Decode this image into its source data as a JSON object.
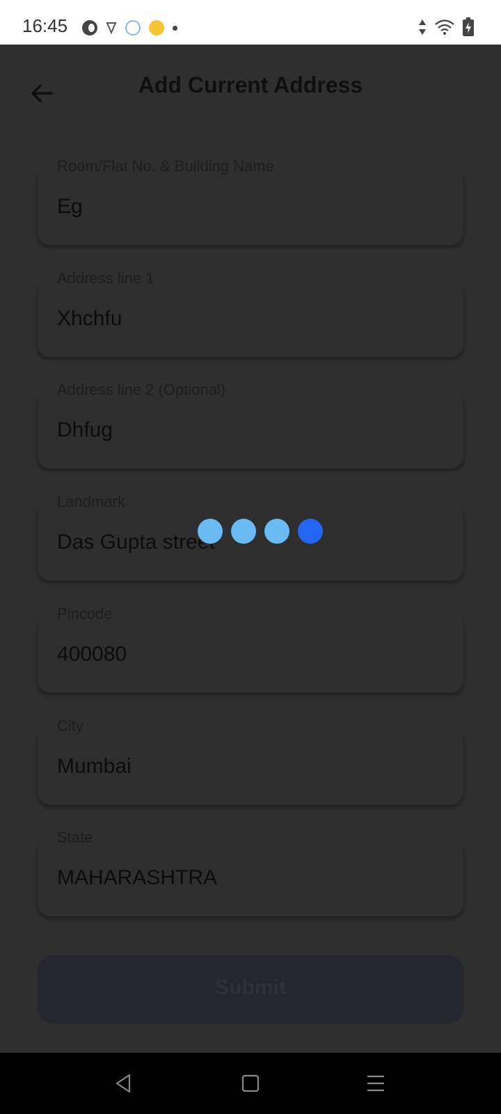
{
  "status_bar": {
    "time": "16:45",
    "left_icons": [
      "circle-c-icon",
      "vpn-icon",
      "app-icon",
      "emoji-icon",
      "dot-icon"
    ],
    "right_icons": [
      "data-arrows-icon",
      "wifi-icon",
      "battery-charging-icon"
    ]
  },
  "header": {
    "title": "Add Current Address",
    "back_icon": "arrow-left-icon"
  },
  "form": {
    "fields": [
      {
        "label": "Room/Flat No. & Building Name",
        "value": "Eg"
      },
      {
        "label": "Address line 1",
        "value": "Xhchfu"
      },
      {
        "label": "Address line 2 (Optional)",
        "value": "Dhfug"
      },
      {
        "label": "Landmark",
        "value": "Das Gupta street"
      },
      {
        "label": "Pincode",
        "value": "400080"
      },
      {
        "label": "City",
        "value": "Mumbai"
      },
      {
        "label": "State",
        "value": "MAHARASHTRA"
      }
    ],
    "submit_label": "Submit"
  },
  "loader": {
    "dots": 4,
    "active_index": 3
  },
  "colors": {
    "overlay": "#2f2f2f",
    "loader_dot": "#6abaf3",
    "loader_dot_active": "#2466f2"
  },
  "nav_bar": {
    "buttons": [
      "back-triangle-icon",
      "home-square-icon",
      "menu-lines-icon"
    ]
  }
}
